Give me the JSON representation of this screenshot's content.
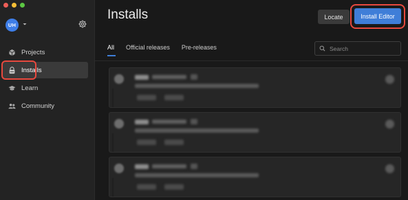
{
  "sidebar": {
    "avatar_initials": "UH",
    "items": [
      {
        "label": "Projects",
        "icon": "cube-icon",
        "active": false
      },
      {
        "label": "Installs",
        "icon": "lock-icon",
        "active": true
      },
      {
        "label": "Learn",
        "icon": "graduation-cap-icon",
        "active": false
      },
      {
        "label": "Community",
        "icon": "people-icon",
        "active": false
      }
    ]
  },
  "header": {
    "title": "Installs",
    "locate_label": "Locate",
    "install_editor_label": "Install Editor"
  },
  "tabs": [
    {
      "label": "All",
      "active": true
    },
    {
      "label": "Official releases",
      "active": false
    },
    {
      "label": "Pre-releases",
      "active": false
    }
  ],
  "search": {
    "placeholder": "Search",
    "value": ""
  },
  "install_rows": 3,
  "colors": {
    "accent": "#3f7ed8",
    "highlight": "#e8493e",
    "background": "#191919",
    "sidebar": "#232323"
  }
}
